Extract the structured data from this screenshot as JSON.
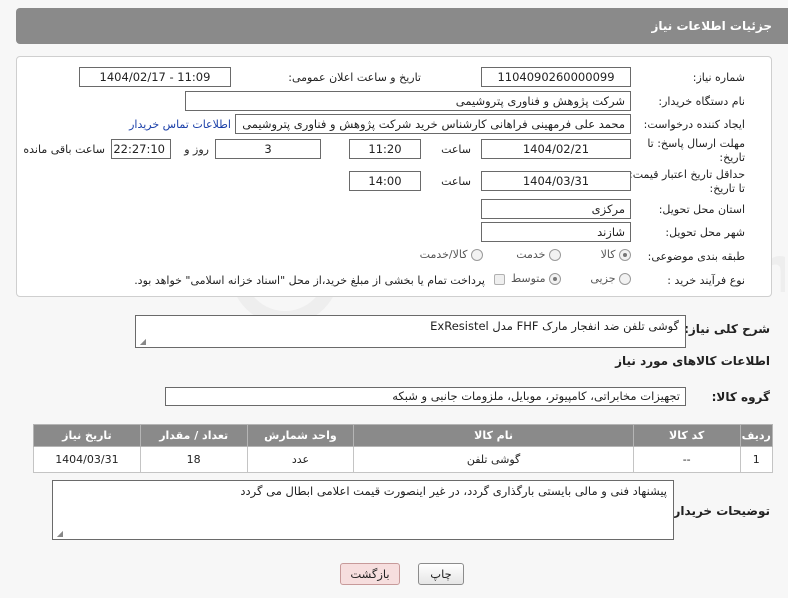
{
  "header": {
    "title": "جزئیات اطلاعات نیاز"
  },
  "fields": {
    "need_number_label": "شماره نیاز:",
    "need_number": "1104090260000099",
    "announce_label": "تاریخ و ساعت اعلان عمومی:",
    "announce_value": "1404/02/17 - 11:09",
    "buyer_org_label": "نام دستگاه خریدار:",
    "buyer_org": "شرکت پژوهش و فناوری پتروشیمی",
    "creator_label": "ایجاد کننده درخواست:",
    "creator": "محمد علی فرمهینی فراهانی کارشناس خرید شرکت پژوهش و فناوری پتروشیمی",
    "buyer_contact_link": "اطلاعات تماس خریدار",
    "deadline_label_1": "مهلت ارسال پاسخ: تا",
    "deadline_label_2": "تاریخ:",
    "deadline_date": "1404/02/21",
    "hour_label": "ساعت",
    "deadline_time": "11:20",
    "days_value": "3",
    "days_label": "روز و",
    "remaining_time": "22:27:10",
    "remaining_label": "ساعت باقی مانده",
    "validity_label_1": "حداقل تاریخ اعتبار قیمت:",
    "validity_label_2": "تا تاریخ:",
    "validity_date": "1404/03/31",
    "validity_hour_label": "ساعت",
    "validity_time": "14:00",
    "province_label": "استان محل تحویل:",
    "province": "مرکزی",
    "city_label": "شهر محل تحویل:",
    "city": "شازند",
    "category_label": "طبقه بندی موضوعی:",
    "category_options": [
      "کالا",
      "خدمت",
      "کالا/خدمت"
    ],
    "category_selected": "کالا",
    "process_label": "نوع فرآیند خرید :",
    "process_options": [
      "جزیی",
      "متوسط"
    ],
    "process_selected": "متوسط",
    "payment_note": "پرداخت تمام یا بخشی از مبلغ خرید،از محل \"اسناد خزانه اسلامی\" خواهد بود."
  },
  "description": {
    "label": "شرح کلی نیاز:",
    "value": "گوشی تلفن ضد انفجار مارک FHF مدل ExResistel"
  },
  "goods": {
    "section_title": "اطلاعات کالاهای مورد نیاز",
    "group_label": "گروه کالا:",
    "group_value": "تجهیزات مخابراتی، کامپیوتر، موبایل، ملزومات جانبی و شبکه",
    "columns": [
      "ردیف",
      "کد کالا",
      "نام کالا",
      "واحد شمارش",
      "تعداد / مقدار",
      "تاریخ نیاز"
    ],
    "rows": [
      [
        "1",
        "--",
        "گوشی تلفن",
        "عدد",
        "18",
        "1404/03/31"
      ]
    ]
  },
  "buyer_notes": {
    "label": "توضیحات خریدار:",
    "value": "پیشنهاد فنی و مالی بایستی بارگذاری گردد، در غیر اینصورت قیمت اعلامی ابطال می گردد"
  },
  "buttons": {
    "print": "چاپ",
    "back": "بازگشت"
  },
  "watermark": {
    "text": "AriaTender.neT"
  }
}
